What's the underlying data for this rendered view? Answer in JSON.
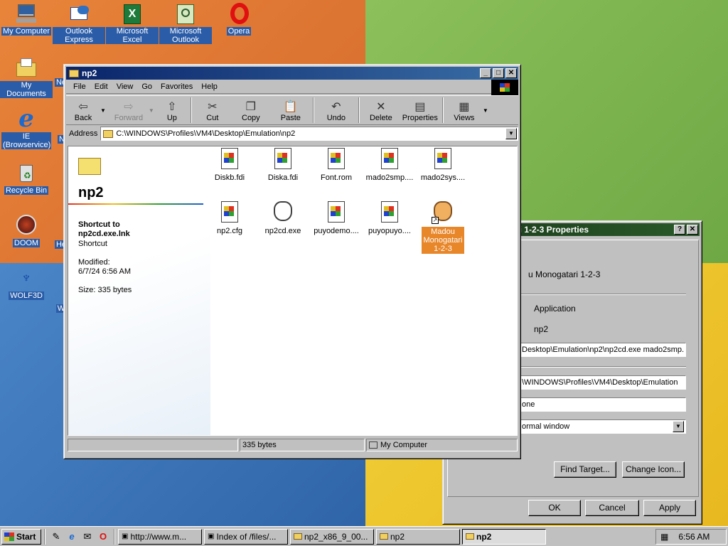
{
  "desktop": {
    "icons": [
      {
        "label": "My Computer",
        "icon": "my-computer-icon"
      },
      {
        "label": "Outlook Express",
        "icon": "outlook-express-icon"
      },
      {
        "label": "Microsoft Excel",
        "icon": "excel-icon"
      },
      {
        "label": "Microsoft Outlook",
        "icon": "outlook-icon"
      },
      {
        "label": "Opera",
        "icon": "opera-icon"
      },
      {
        "label": "My Documents",
        "icon": "my-documents-icon"
      },
      {
        "label": "IE (Browservice)",
        "icon": "ie-icon"
      },
      {
        "label": "Recycle Bin",
        "icon": "recycle-bin-icon"
      },
      {
        "label": "DOOM",
        "icon": "doom-icon"
      },
      {
        "label": "WOLF3D",
        "icon": "wolf3d-icon"
      },
      {
        "label": "Ne",
        "icon": "partial-icon"
      },
      {
        "label": "N",
        "icon": "partial-icon"
      },
      {
        "label": "He",
        "icon": "partial-icon"
      },
      {
        "label": "W",
        "icon": "partial-icon"
      }
    ]
  },
  "explorer": {
    "title": "np2",
    "menu": [
      "File",
      "Edit",
      "View",
      "Go",
      "Favorites",
      "Help"
    ],
    "toolbar": {
      "back": "Back",
      "forward": "Forward",
      "up": "Up",
      "cut": "Cut",
      "copy": "Copy",
      "paste": "Paste",
      "undo": "Undo",
      "delete": "Delete",
      "properties": "Properties",
      "views": "Views"
    },
    "address_label": "Address",
    "address": "C:\\WINDOWS\\Profiles\\VM4\\Desktop\\Emulation\\np2",
    "panel": {
      "folder_name": "np2",
      "selected_title": "Shortcut to np2cd.exe.lnk",
      "selected_type": "Shortcut",
      "modified_label": "Modified:",
      "modified_value": "6/7/24 6:56 AM",
      "size": "Size: 335 bytes"
    },
    "files": [
      {
        "name": "Diskb.fdi",
        "icon": "document-icon"
      },
      {
        "name": "Diska.fdi",
        "icon": "document-icon"
      },
      {
        "name": "Font.rom",
        "icon": "document-icon"
      },
      {
        "name": "mado2smp....",
        "icon": "document-icon"
      },
      {
        "name": "mado2sys....",
        "icon": "document-icon"
      },
      {
        "name": "np2.cfg",
        "icon": "document-icon"
      },
      {
        "name": "np2cd.exe",
        "icon": "cat-icon"
      },
      {
        "name": "puyodemo....",
        "icon": "document-icon"
      },
      {
        "name": "puyopuyo....",
        "icon": "document-icon"
      },
      {
        "name": "Madou Monogatari 1-2-3",
        "icon": "cat-shortcut-icon"
      }
    ],
    "status": {
      "size": "335 bytes",
      "zone": "My Computer"
    }
  },
  "properties": {
    "title": "ri 1-2-3 Properties",
    "name": "u Monogatari 1-2-3",
    "type_value": "Application",
    "location_value": "np2",
    "target": "Desktop\\Emulation\\np2\\np2cd.exe mado2smp.",
    "start_in": "\\WINDOWS\\Profiles\\VM4\\Desktop\\Emulation",
    "shortcut_key": "one",
    "run": "ormal window",
    "find_target": "Find Target...",
    "change_icon": "Change Icon...",
    "ok": "OK",
    "cancel": "Cancel",
    "apply": "Apply"
  },
  "taskbar": {
    "start": "Start",
    "tasks": [
      {
        "label": "http://www.m...",
        "icon": "ie-page-icon"
      },
      {
        "label": "Index of /files/...",
        "icon": "ie-page-icon"
      },
      {
        "label": "np2_x86_9_00...",
        "icon": "folder-icon"
      },
      {
        "label": "np2",
        "icon": "folder-icon"
      },
      {
        "label": "np2",
        "icon": "folder-icon"
      }
    ],
    "clock": "6:56 AM"
  }
}
